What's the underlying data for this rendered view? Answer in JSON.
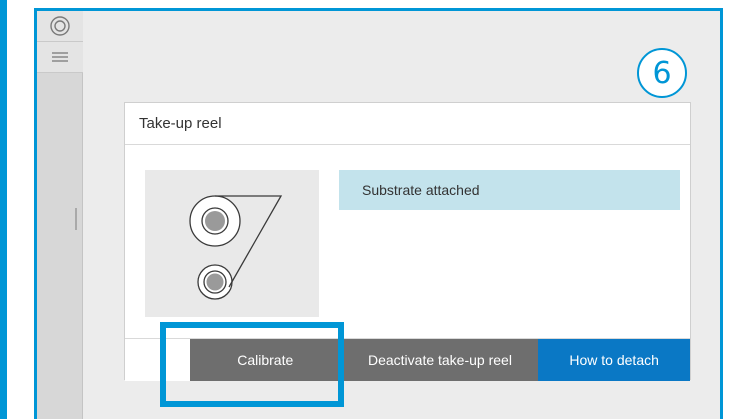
{
  "theme": {
    "accent": "#0096d6",
    "primary_button": "#0a78c5",
    "secondary_button": "#6e6e6e",
    "banner": "#c3e3ec"
  },
  "step": {
    "number": "6"
  },
  "rail": {
    "icons": [
      "reel-icon",
      "list-icon"
    ]
  },
  "dialog": {
    "title": "Take-up reel",
    "status": "Substrate attached",
    "buttons": {
      "calibrate": "Calibrate",
      "deactivate": "Deactivate take-up reel",
      "detach": "How to detach"
    }
  }
}
